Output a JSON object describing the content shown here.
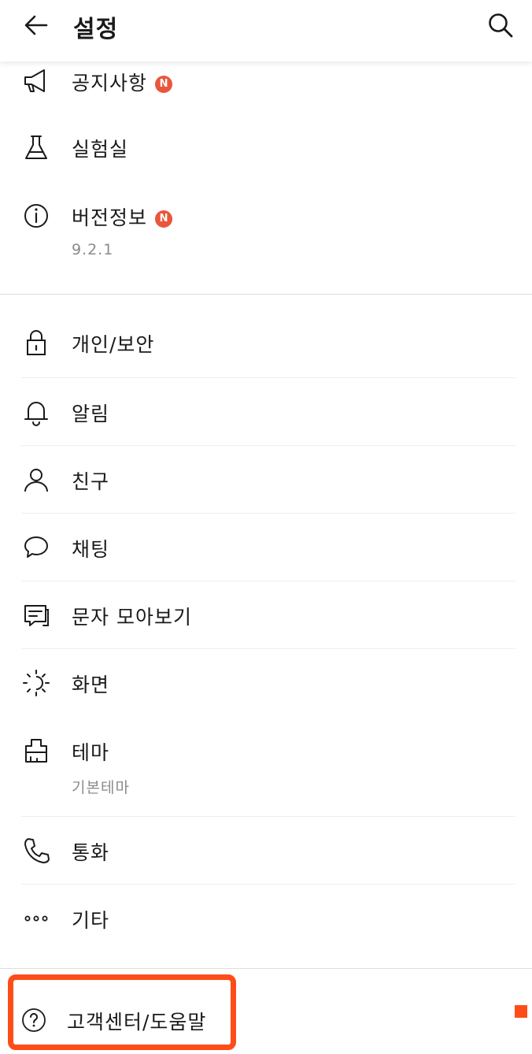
{
  "header": {
    "title": "설정",
    "back_icon": "arrow-left-icon",
    "search_icon": "search-icon"
  },
  "items": {
    "notice": {
      "label": "공지사항",
      "badge": "N",
      "icon": "megaphone-icon"
    },
    "lab": {
      "label": "실험실",
      "icon": "flask-icon"
    },
    "version": {
      "label": "버전정보",
      "badge": "N",
      "sub": "9.2.1",
      "icon": "info-icon"
    },
    "privacy": {
      "label": "개인/보안",
      "icon": "lock-icon"
    },
    "notification": {
      "label": "알림",
      "icon": "bell-icon"
    },
    "friends": {
      "label": "친구",
      "icon": "person-icon"
    },
    "chat": {
      "label": "채팅",
      "icon": "speech-bubble-icon"
    },
    "sms": {
      "label": "문자 모아보기",
      "icon": "message-icon"
    },
    "display": {
      "label": "화면",
      "icon": "brightness-icon"
    },
    "theme": {
      "label": "테마",
      "sub": "기본테마",
      "icon": "paint-brush-icon"
    },
    "call": {
      "label": "통화",
      "icon": "phone-icon"
    },
    "etc": {
      "label": "기타",
      "icon": "more-icon"
    },
    "help": {
      "label": "고객센터/도움말",
      "icon": "question-icon"
    }
  },
  "colors": {
    "badge": "#e8573b",
    "highlight": "#ff4d1a"
  }
}
